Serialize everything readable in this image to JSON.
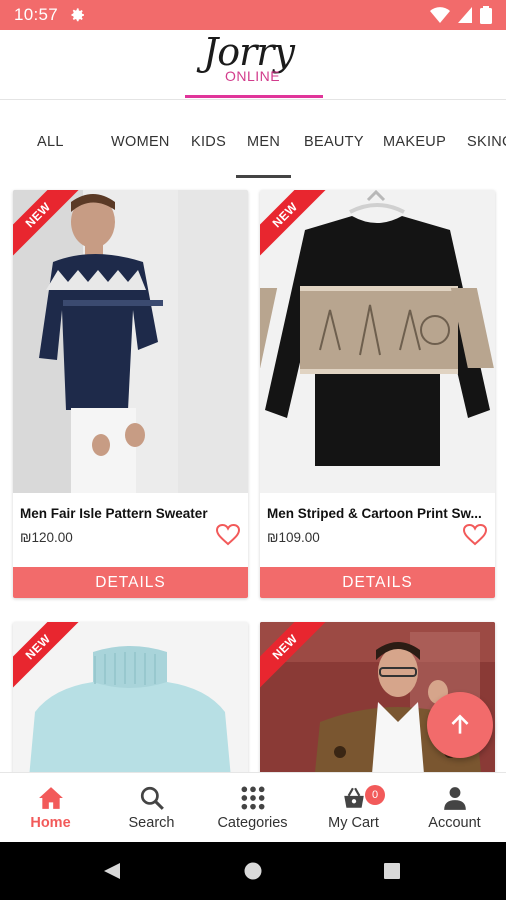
{
  "status_bar": {
    "time": "10:57"
  },
  "logo": {
    "script_text": "Jorry",
    "sub_text": "ONLINE"
  },
  "categories": [
    {
      "label": "ALL"
    },
    {
      "label": "WOMEN"
    },
    {
      "label": "KIDS"
    },
    {
      "label": "MEN",
      "selected": true
    },
    {
      "label": "BEAUTY"
    },
    {
      "label": "MAKEUP"
    },
    {
      "label": "SKINCARE"
    }
  ],
  "products": [
    {
      "badge": "NEW",
      "title": "Men Fair Isle Pattern Sweater",
      "price": "₪120.00",
      "button": "DETAILS"
    },
    {
      "badge": "NEW",
      "title": "Men Striped & Cartoon Print Sw...",
      "price": "₪109.00",
      "button": "DETAILS"
    },
    {
      "badge": "NEW"
    },
    {
      "badge": "NEW"
    }
  ],
  "bottom_nav": [
    {
      "label": "Home",
      "icon": "home-icon",
      "active": true
    },
    {
      "label": "Search",
      "icon": "search-icon"
    },
    {
      "label": "Categories",
      "icon": "grid-icon"
    },
    {
      "label": "My Cart",
      "icon": "cart-icon",
      "badge": "0"
    },
    {
      "label": "Account",
      "icon": "account-icon"
    }
  ],
  "colors": {
    "accent": "#f26b6b",
    "ribbon": "#e8262f",
    "logo_pink": "#e0359a"
  }
}
